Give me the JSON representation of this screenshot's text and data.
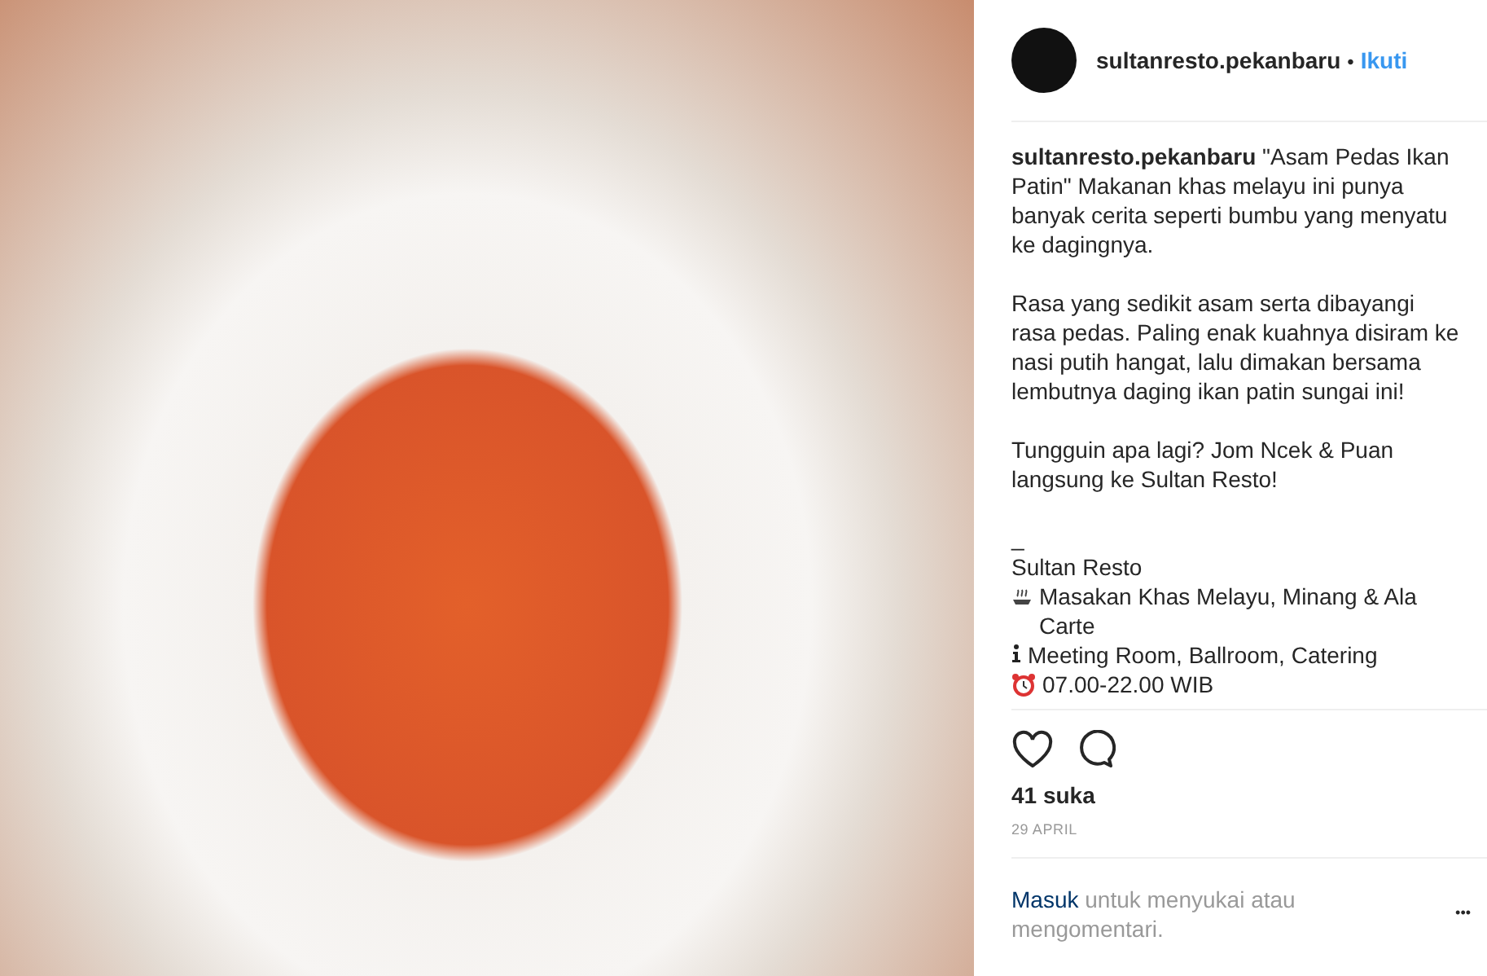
{
  "post": {
    "photo": {
      "kind": "photo"
    },
    "header": {
      "username": "sultanresto.pekanbaru",
      "separator": "•",
      "follow": "Ikuti"
    },
    "caption": {
      "username": "sultanresto.pekanbaru",
      "paragraphs": [
        "\"Asam Pedas Ikan Patin\" Makanan khas melayu ini punya banyak cerita seperti bumbu yang menyatu ke dagingnya.",
        "Rasa yang sedikit asam serta dibayangi rasa pedas. Paling enak kuahnya disiram ke nasi putih hangat, lalu dimakan bersama lembutnya daging ikan patin sungai ini!",
        "Tungguin apa lagi? Jom Ncek & Puan langsung ke Sultan Resto!"
      ],
      "lines": [
        {
          "kind": "plain",
          "text": "_"
        },
        {
          "kind": "plain",
          "text": "Sultan Resto"
        },
        {
          "kind": "steam",
          "text": "Masakan Khas Melayu, Minang & Ala Carte"
        },
        {
          "kind": "info",
          "text": "Meeting Room, Ballroom, Catering"
        },
        {
          "kind": "clock",
          "text": "07.00-22.00 WIB"
        }
      ]
    },
    "likes": "41 suka",
    "date": "29 APRIL",
    "login": {
      "link": "Masuk",
      "text": "untuk menyukai atau mengomentari."
    },
    "more": "•••"
  }
}
